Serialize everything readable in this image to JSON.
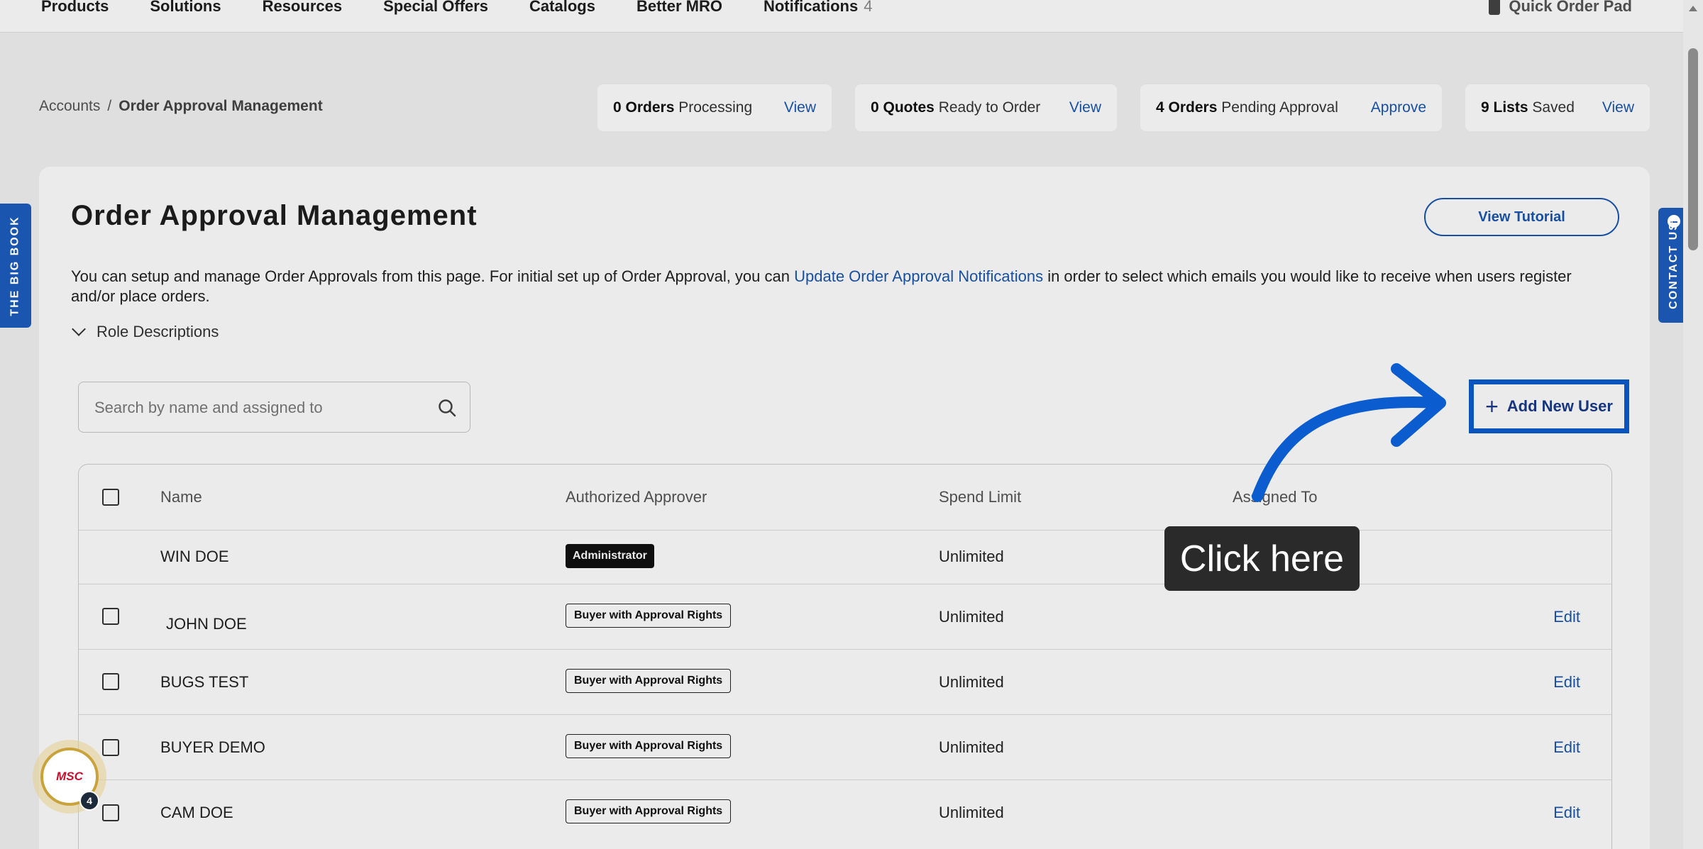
{
  "nav": {
    "items": [
      "Products",
      "Solutions",
      "Resources",
      "Special Offers",
      "Catalogs",
      "Better MRO",
      "Notifications"
    ],
    "notifications_count": "4",
    "quick_order": "Quick Order Pad"
  },
  "breadcrumb": {
    "root": "Accounts",
    "separator": "/",
    "current": "Order Approval Management"
  },
  "stats": [
    {
      "bold": "0 Orders",
      "rest": "Processing",
      "action": "View"
    },
    {
      "bold": "0 Quotes",
      "rest": "Ready to Order",
      "action": "View"
    },
    {
      "bold": "4 Orders",
      "rest": "Pending Approval",
      "action": "Approve"
    },
    {
      "bold": "9 Lists",
      "rest": "Saved",
      "action": "View"
    }
  ],
  "page": {
    "title": "Order Approval Management",
    "tutorial_button": "View Tutorial",
    "description_before": "You can setup and manage Order Approvals from this page. For initial set up of Order Approval, you can ",
    "description_link": "Update Order Approval Notifications",
    "description_after": " in order to select which emails you would like to receive when users register and/or place orders.",
    "roles_toggle": "Role Descriptions",
    "search_placeholder": "Search by name and assigned to",
    "add_user": "Add New User"
  },
  "table": {
    "headers": {
      "name": "Name",
      "approver": "Authorized Approver",
      "spend": "Spend Limit",
      "assigned": "Assigned To"
    },
    "rows": [
      {
        "name": "WIN DOE",
        "role": "Administrator",
        "spend": "Unlimited",
        "edit": ""
      },
      {
        "name": "JOHN DOE",
        "role": "Buyer with Approval Rights",
        "spend": "Unlimited",
        "edit": "Edit"
      },
      {
        "name": "BUGS TEST",
        "role": "Buyer with Approval Rights",
        "spend": "Unlimited",
        "edit": "Edit"
      },
      {
        "name": "BUYER DEMO",
        "role": "Buyer with Approval Rights",
        "spend": "Unlimited",
        "edit": "Edit"
      },
      {
        "name": "CAM DOE",
        "role": "Buyer with Approval Rights",
        "spend": "Unlimited",
        "edit": "Edit"
      }
    ]
  },
  "side_tabs": {
    "left": "THE BIG BOOK",
    "right": "CONTACT US"
  },
  "msc": {
    "logo": "MSC",
    "count": "4"
  },
  "callout": "Click here",
  "colors": {
    "accent": "#1a56b0",
    "highlight": "#0b5ccf",
    "admin_badge": "#111111"
  }
}
